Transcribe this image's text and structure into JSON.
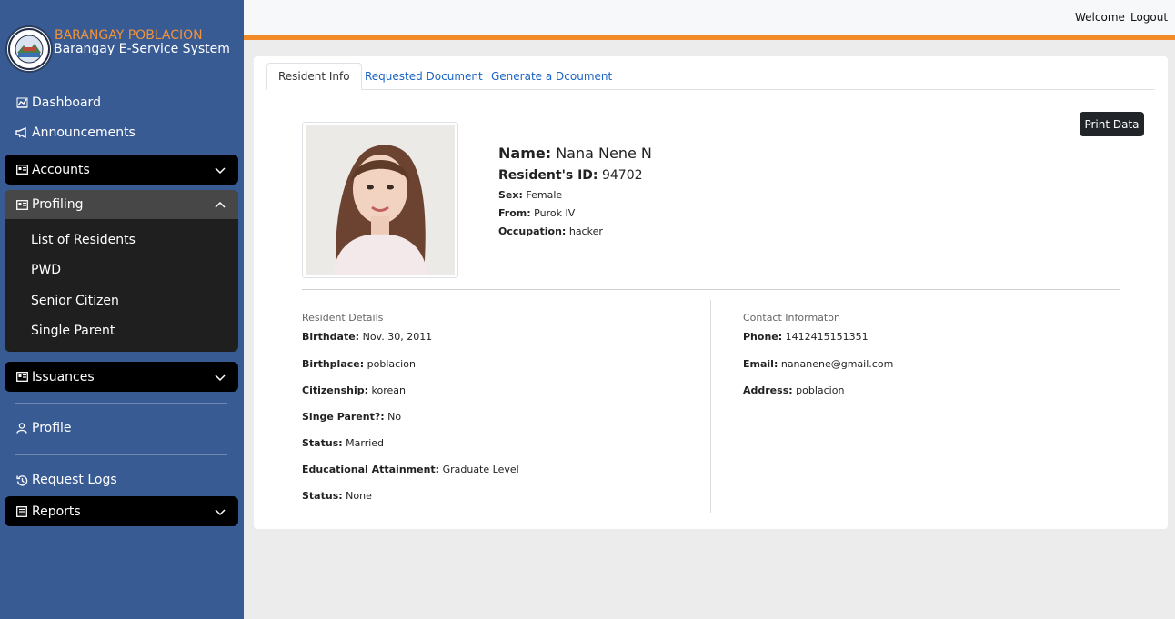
{
  "brand": {
    "title": "BARANGAY POBLACION",
    "subtitle": "Barangay E-Service System"
  },
  "sidebar": {
    "dashboard": "Dashboard",
    "announcements": "Announcements",
    "accounts": "Accounts",
    "profiling": "Profiling",
    "profiling_items": [
      "List of Residents",
      "PWD",
      "Senior Citizen",
      "Single Parent"
    ],
    "issuances": "Issuances",
    "profile": "Profile",
    "request_logs": "Request Logs",
    "reports": "Reports"
  },
  "topbar": {
    "welcome": "Welcome",
    "logout": "Logout"
  },
  "tabs": [
    "Resident Info",
    "Requested Document",
    "Generate a Dcoument"
  ],
  "print_button": "Print Data",
  "resident": {
    "name_label": "Name:",
    "name": "Nana Nene N",
    "id_label": "Resident's ID:",
    "id": "94702",
    "sex_label": "Sex:",
    "sex": "Female",
    "from_label": "From:",
    "from": "Purok IV",
    "occupation_label": "Occupation:",
    "occupation": "hacker"
  },
  "details": {
    "title": "Resident Details",
    "fields": [
      {
        "label": "Birthdate:",
        "value": "Nov. 30, 2011"
      },
      {
        "label": "Birthplace:",
        "value": "poblacion"
      },
      {
        "label": "Citizenship:",
        "value": "korean"
      },
      {
        "label": "Singe Parent?:",
        "value": "No"
      },
      {
        "label": "Status:",
        "value": "Married"
      },
      {
        "label": "Educational Attainment:",
        "value": "Graduate Level"
      },
      {
        "label": "Status:",
        "value": "None"
      }
    ]
  },
  "contact": {
    "title": "Contact Informaton",
    "fields": [
      {
        "label": "Phone:",
        "value": "1412415151351"
      },
      {
        "label": "Email:",
        "value": "nananene@gmail.com"
      },
      {
        "label": "Address:",
        "value": "poblacion"
      }
    ]
  },
  "colors": {
    "sidebar": "#385b94",
    "accent": "#f28a27",
    "brand_title": "#f0923a",
    "tab_link": "#1a63c4"
  }
}
